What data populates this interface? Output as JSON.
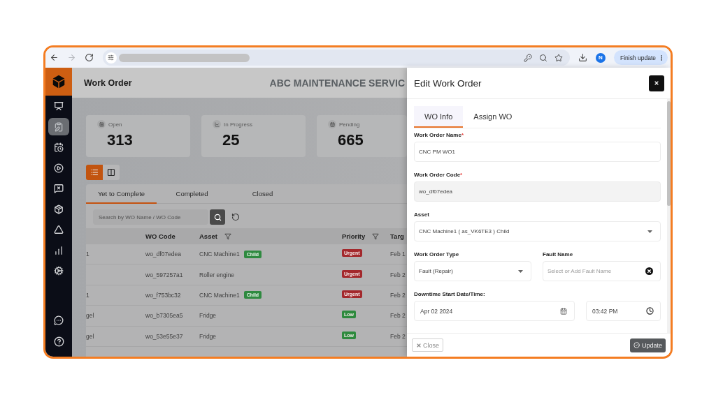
{
  "browser": {
    "forward_disabled": true,
    "profile_initial": "N",
    "update_label": "Finish update"
  },
  "sidebar": {
    "items": [
      {
        "selected": false
      },
      {
        "selected": true
      },
      {
        "selected": false
      },
      {
        "selected": false
      },
      {
        "selected": false
      },
      {
        "selected": false
      },
      {
        "selected": false
      },
      {
        "selected": false
      },
      {
        "selected": false
      }
    ]
  },
  "header": {
    "title": "Work Order",
    "company": "ABC MAINTENANCE SERVIC"
  },
  "stats": [
    {
      "label": "Open",
      "value": "313"
    },
    {
      "label": "In Progress",
      "value": "25"
    },
    {
      "label": "Pending",
      "value": "665"
    }
  ],
  "view_toggle": [
    {
      "selected": true
    },
    {
      "selected": false
    }
  ],
  "tabs": [
    {
      "label": "Yet to Complete",
      "selected": true
    },
    {
      "label": "Completed",
      "selected": false
    },
    {
      "label": "Closed",
      "selected": false
    }
  ],
  "search": {
    "placeholder": "Search by WO Name / WO Code"
  },
  "table": {
    "columns": [
      {
        "label": "WO Code",
        "filter": false
      },
      {
        "label": "Asset",
        "filter": true
      },
      {
        "label": "Priority",
        "filter": true
      },
      {
        "label": "Targ",
        "filter": false
      }
    ],
    "rows": [
      {
        "column_1": "1",
        "wo_code": "wo_df07edea",
        "asset": "CNC Machine1",
        "badge": "Child",
        "priority": {
          "label": "Urgent",
          "color": "#a3282c"
        },
        "column_5": "Feb 1"
      },
      {
        "wo_code": "wo_597257a1",
        "asset": "Roller engine",
        "priority": {
          "label": "Urgent",
          "color": "#a3282c"
        },
        "column_5": "Feb 2"
      },
      {
        "column_1": "1",
        "wo_code": "wo_f753bc32",
        "asset": "CNC Machine1",
        "badge": "Child",
        "priority": {
          "label": "Urgent",
          "color": "#a3282c"
        },
        "column_5": "Feb 2"
      },
      {
        "column_1": "gel",
        "wo_code": "wo_b7305ea5",
        "asset": "Fridge",
        "priority": {
          "label": "Low",
          "color": "#2e8a3e"
        },
        "column_5": "Feb 2"
      },
      {
        "column_1": "gel",
        "wo_code": "wo_53e55e37",
        "asset": "Fridge",
        "priority": {
          "label": "Low",
          "color": "#2e8a3e"
        },
        "column_5": "Feb 2"
      }
    ]
  },
  "drawer": {
    "title": "Edit Work Order",
    "tabs": [
      {
        "label": "WO Info",
        "selected": true
      },
      {
        "label": "Assign WO",
        "selected": false
      }
    ],
    "fields": [
      {
        "kind": "text",
        "label": "Work Order Name",
        "required_mark": "*",
        "disabled": false,
        "value": "CNC PM WO1"
      },
      {
        "kind": "text",
        "label": "Work Order Code",
        "required_mark": "*",
        "disabled": true,
        "value": "wo_df07edea"
      },
      {
        "kind": "select",
        "label": "Asset",
        "value": "CNC Machine1 ( as_VK6TE3 ) Child"
      }
    ],
    "type_row": [
      {
        "kind": "select",
        "label": "Work Order Type",
        "value": "Fault (Repair)"
      },
      {
        "kind": "combo",
        "label": "Fault Name",
        "placeholder": "Select or Add Fault Name"
      }
    ],
    "downtime": {
      "label": "Downtime Start Date/Time:",
      "date": "Apr 02 2024",
      "time": "03:42 PM"
    },
    "footer": {
      "close": "Close",
      "update": "Update"
    }
  }
}
